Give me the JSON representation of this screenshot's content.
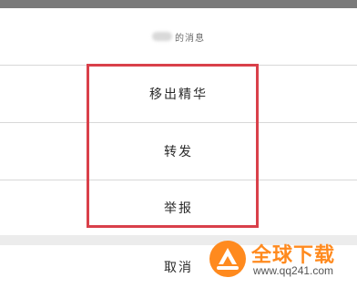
{
  "menu": {
    "header_text": "的消息",
    "remove_featured_label": "移出精华",
    "forward_label": "转发",
    "report_label": "举报",
    "cancel_label": "取消"
  },
  "watermark": {
    "title": "全球下载",
    "url": "www.qq241.com"
  },
  "colors": {
    "highlight": "#d9404a",
    "watermark_orange": "#ff8a1e",
    "status_strip": "#7a7a7a"
  }
}
